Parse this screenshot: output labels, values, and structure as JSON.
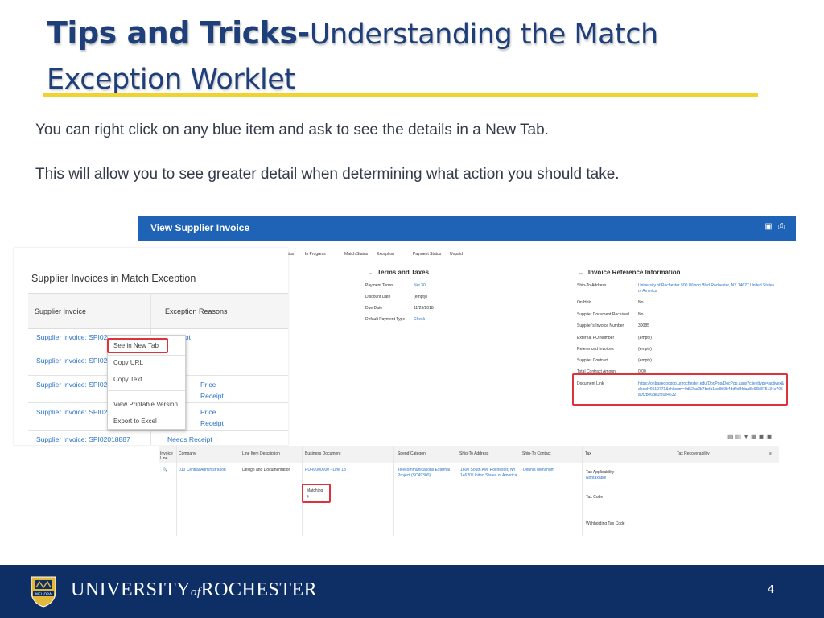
{
  "slide": {
    "title_bold": "Tips and Tricks-",
    "title_rest": "Understanding the Match Exception Worklet",
    "paragraph1": "You can right click on any blue item and ask to see the details in a New Tab.",
    "paragraph2": "This will allow you to see greater detail when determining what action you should take.",
    "page_number": "4"
  },
  "workday": {
    "window_title": "View Supplier Invoice",
    "status_row": [
      {
        "label": "Status",
        "value": "In Progress"
      },
      {
        "label": "Match Status",
        "value": "Exception"
      },
      {
        "label": "Payment Status",
        "value": "Unpaid"
      }
    ],
    "terms": {
      "heading": "Terms and Taxes",
      "fields": [
        {
          "label": "Payment Terms",
          "value": "Net 30"
        },
        {
          "label": "Discount Date",
          "value": "(empty)"
        },
        {
          "label": "Due Date",
          "value": "11/29/2018"
        },
        {
          "label": "Default Payment Type",
          "value": "Check"
        }
      ]
    },
    "invoice_ref": {
      "heading": "Invoice Reference Information",
      "fields": [
        {
          "label": "Ship-To Address",
          "value": "University of Rochester 500 Wilson Blvd Rochester, NY 14627 United States of America"
        },
        {
          "label": "On Hold",
          "value": "No"
        },
        {
          "label": "Supplier Document Received",
          "value": "No"
        },
        {
          "label": "Supplier's Invoice Number",
          "value": "30085"
        },
        {
          "label": "External PO Number",
          "value": "(empty)"
        },
        {
          "label": "Referenced Invoices",
          "value": "(empty)"
        },
        {
          "label": "Supplier Contract",
          "value": "(empty)"
        },
        {
          "label": "Total Contract Amount",
          "value": "0.00"
        },
        {
          "label": "Document Link",
          "value": "https://onbasedocpop.ur.rochester.edu/DocPop/DocPop.aspx?clienttype=activex&docid=9510771&chksum=0d52ac2b7befa1be9b9b4dd4d8fdaa8e96b875134e705a0f2be6de1f80e4632"
        }
      ]
    },
    "table": {
      "headers": [
        "Invoice Line",
        "Company",
        "Line Item Description",
        "Business Document",
        "Spend Category",
        "Ship-To Address",
        "Ship-To Contact",
        "Tax",
        "Tax Recoverability"
      ],
      "row": {
        "company": "010 Central Administration",
        "description": "Design and Documentation",
        "business_document": "PUR0000000 - Line 13",
        "matching_label": "Matching",
        "matching_value": "4",
        "spend_category": "Telecommunications External Project (SC49300)",
        "ship_to": "1600 South Ave Rochester, NY 14620 United States of America",
        "contact": "Dennis Menshom",
        "tax_applicability_label": "Tax Applicability",
        "tax_applicability_value": "Nontaxable",
        "tax_code_label": "Tax Code",
        "withholding_label": "Withholding Tax Code"
      }
    }
  },
  "worklet": {
    "title": "Supplier Invoices in Match Exception",
    "col1": "Supplier Invoice",
    "col2": "Exception Reasons",
    "rows": [
      {
        "invoice": "Supplier Invoice: SPI02024004",
        "reason": "Receipt"
      },
      {
        "invoice": "Supplier Invoice: SPI020",
        "reason": ""
      },
      {
        "invoice": "Supplier Invoice: SPI020",
        "reason": "Price",
        "reason2": "Receipt"
      },
      {
        "invoice": "Supplier Invoice: SPI020",
        "reason": "Price",
        "reason2": "Receipt"
      },
      {
        "invoice": "Supplier Invoice: SPI02018887",
        "reason": "Needs Receipt"
      }
    ],
    "context_menu": [
      "See in New Tab",
      "Copy URL",
      "Copy Text",
      "View Printable Version",
      "Export to Excel"
    ]
  },
  "footer": {
    "university": "UNIVERSITY",
    "of": "of",
    "rochester": "ROCHESTER",
    "logo_text": "MELIORA"
  },
  "colors": {
    "title": "#1f3f7a",
    "rule": "#f2d22e",
    "workday_bar": "#1e63b5",
    "link": "#2a72c8",
    "highlight": "#e0323a",
    "footer": "#0d2f66"
  }
}
